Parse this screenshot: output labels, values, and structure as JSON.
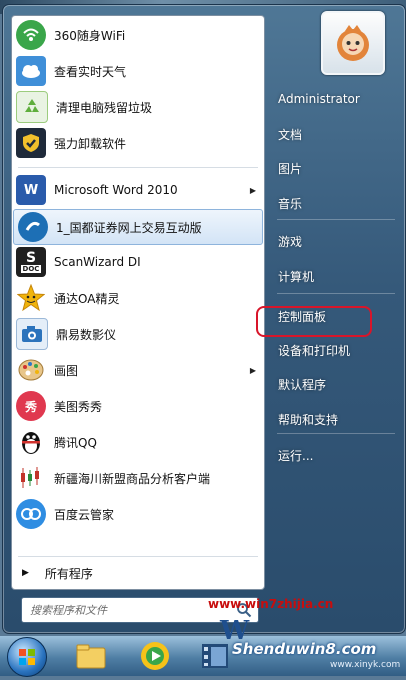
{
  "left_panel": {
    "items": [
      {
        "label": "360随身WiFi",
        "icon": "wifi-360-icon",
        "color": "#3aa64a"
      },
      {
        "label": "查看实时天气",
        "icon": "weather-icon",
        "color": "#3f8fd8"
      },
      {
        "label": "清理电脑残留垃圾",
        "icon": "recycle-icon",
        "color": "#5fae3d"
      },
      {
        "label": "强力卸载软件",
        "icon": "uninstall-shield-icon",
        "color": "#1f2a3a"
      },
      {
        "label": "Microsoft Word 2010",
        "icon": "word-icon",
        "color": "#2a5bab",
        "submenu": true
      },
      {
        "label": "1_国都证券网上交易互动版",
        "icon": "stock-trading-icon",
        "color": "#1d6fb5",
        "highlighted": true
      },
      {
        "label": "ScanWizard DI",
        "icon": "scan-doc-icon",
        "color": "#202020"
      },
      {
        "label": "通达OA精灵",
        "icon": "star-smiley-icon",
        "color": "#f0b40c"
      },
      {
        "label": "鼎易数影仪",
        "icon": "camera-icon",
        "color": "#2b73bc"
      },
      {
        "label": "画图",
        "icon": "paint-palette-icon",
        "color": "#c79a4f",
        "submenu": true
      },
      {
        "label": "美图秀秀",
        "icon": "meitu-icon",
        "color": "#e0384f"
      },
      {
        "label": "腾讯QQ",
        "icon": "qq-penguin-icon",
        "color": "#111111"
      },
      {
        "label": "新疆海川新盟商品分析客户端",
        "icon": "candlestick-icon",
        "color": "#c2332a"
      },
      {
        "label": "百度云管家",
        "icon": "baidu-cloud-icon",
        "color": "#2f8de2"
      }
    ],
    "all_programs": "所有程序",
    "search_placeholder": "搜索程序和文件"
  },
  "right_panel": {
    "items": [
      "Administrator",
      "文档",
      "图片",
      "音乐",
      "游戏",
      "计算机",
      "控制面板",
      "设备和打印机",
      "默认程序",
      "帮助和支持",
      "运行..."
    ],
    "highlight_color": "#d8152a"
  },
  "watermarks": {
    "url": "www.win7zhijia.cn",
    "brand": "Shenduwin8.com",
    "site": "www.xinyk.com",
    "logo": "W"
  },
  "taskbar": {
    "icons": [
      "start-orb-icon",
      "explorer-folder-icon",
      "media-player-icon",
      "video-film-icon"
    ]
  }
}
